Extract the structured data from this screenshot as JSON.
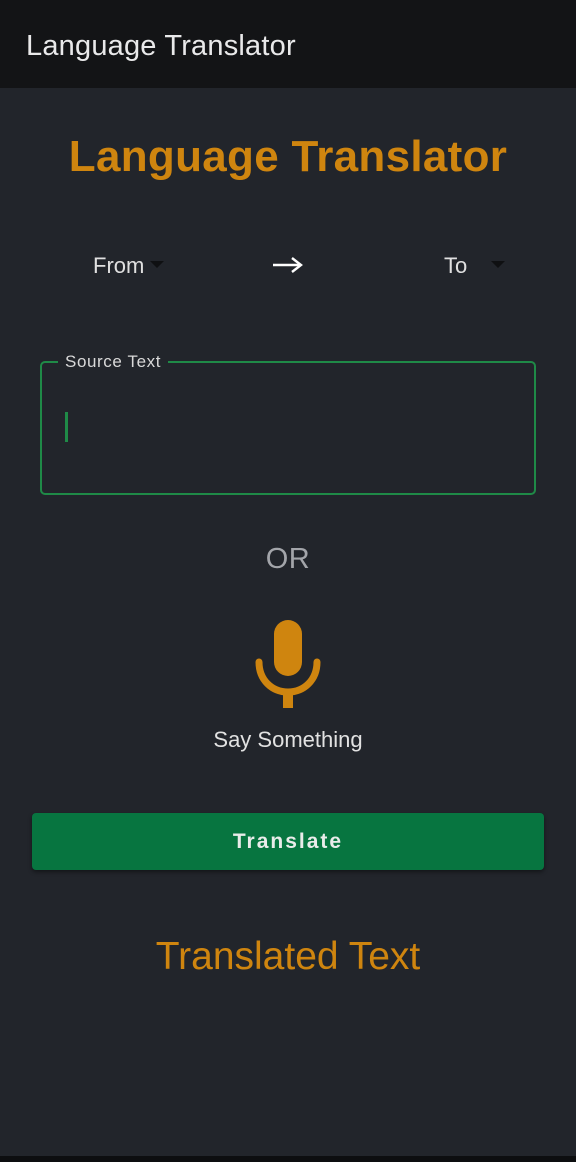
{
  "app_bar": {
    "title": "Language Translator"
  },
  "main": {
    "heading": "Language Translator",
    "from_spinner": {
      "label": "From"
    },
    "to_spinner": {
      "label": "To"
    },
    "direction_icon": "right-arrow-icon",
    "source_text": {
      "label": "Source Text",
      "value": ""
    },
    "or_text": "OR",
    "mic_icon": "microphone-icon",
    "say_something": "Say Something",
    "translate_button": "Translate",
    "translated_text": "Translated Text"
  },
  "colors": {
    "background": "#22252b",
    "app_bar": "#131416",
    "accent": "#cf850f",
    "primary_green": "#077540",
    "focus_border": "#1f8a47"
  }
}
